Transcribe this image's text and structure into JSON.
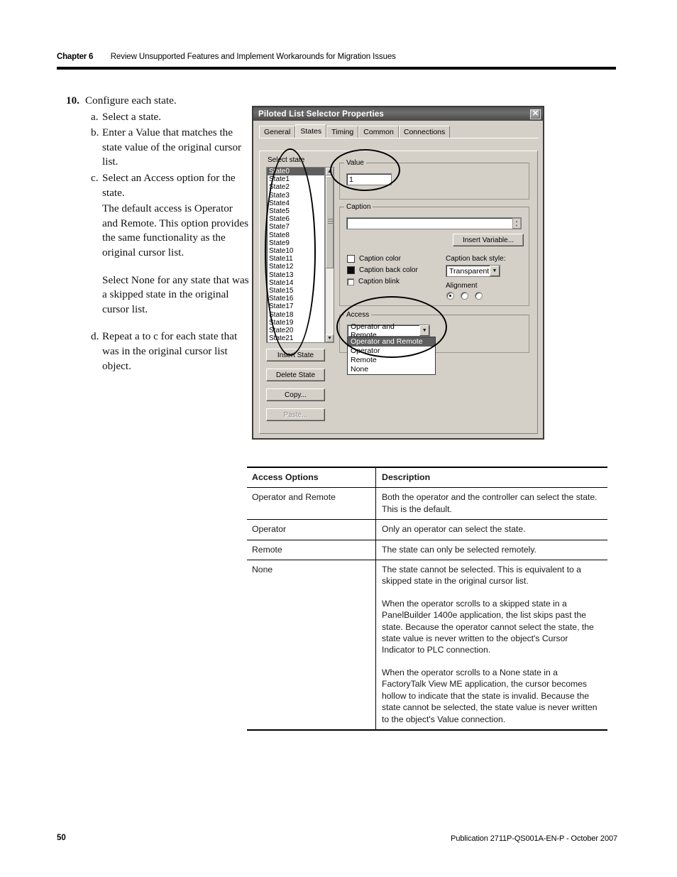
{
  "header": {
    "chapter_label": "Chapter 6",
    "chapter_title": "Review Unsupported Features and Implement Workarounds for Migration Issues"
  },
  "instructions": {
    "step_number": "10.",
    "step_text": "Configure each state.",
    "sub_steps": [
      {
        "letter": "a.",
        "text": "Select a state."
      },
      {
        "letter": "b.",
        "text": "Enter a Value that matches the state value of the original cursor list."
      },
      {
        "letter": "c.",
        "text": "Select an Access option for the state."
      },
      {
        "letter": "d.",
        "text": "Repeat a to c for each state that was in the original cursor list object."
      }
    ],
    "note_default_access": "The default access is Operator and Remote. This option provides the same functionality as the original cursor list.",
    "note_select_none": "Select None for any state that was a skipped state in the original cursor list."
  },
  "dialog": {
    "title": "Piloted List Selector Properties",
    "close_label": "✕",
    "tabs": [
      {
        "label": "General",
        "active": false
      },
      {
        "label": "States",
        "active": true
      },
      {
        "label": "Timing",
        "active": false
      },
      {
        "label": "Common",
        "active": false
      },
      {
        "label": "Connections",
        "active": false
      }
    ],
    "select_state_label": "Select state",
    "states": [
      "State0",
      "State1",
      "State2",
      "State3",
      "State4",
      "State5",
      "State6",
      "State7",
      "State8",
      "State9",
      "State10",
      "State11",
      "State12",
      "State13",
      "State14",
      "State15",
      "State16",
      "State17",
      "State18",
      "State19",
      "State20",
      "State21"
    ],
    "selected_state": "State0",
    "scroll_up_glyph": "▲",
    "scroll_down_glyph": "▼",
    "left_buttons": [
      {
        "label": "Insert State",
        "enabled": true
      },
      {
        "label": "Delete State",
        "enabled": true
      },
      {
        "label": "Copy...",
        "enabled": true
      },
      {
        "label": "Paste...",
        "enabled": false
      }
    ],
    "value_group": {
      "label": "Value",
      "value": "1"
    },
    "caption_group": {
      "label": "Caption",
      "caption_text": "",
      "insert_variable_label": "Insert Variable...",
      "caption_color_label": "Caption color",
      "caption_color_swatch": "#ffffff",
      "caption_back_color_label": "Caption back color",
      "caption_back_color_swatch": "#000000",
      "caption_blink_label": "Caption blink",
      "caption_blink_checked": false,
      "back_style_label": "Caption back style:",
      "back_style_value": "Transparent",
      "alignment_label": "Alignment",
      "alignment_selected_index": 0
    },
    "access_group": {
      "label": "Access",
      "selected": "Operator and Remote",
      "options": [
        "Operator and Remote",
        "Operator",
        "Remote",
        "None"
      ],
      "dropdown_open": true
    }
  },
  "table": {
    "columns": [
      "Access Options",
      "Description"
    ],
    "rows": [
      {
        "option": "Operator and Remote",
        "description": [
          "Both the operator and the controller can select the state. This is the default."
        ]
      },
      {
        "option": "Operator",
        "description": [
          "Only an operator can select the state."
        ]
      },
      {
        "option": "Remote",
        "description": [
          "The state can only be selected remotely."
        ]
      },
      {
        "option": "None",
        "description": [
          "The state cannot be selected. This is equivalent to a skipped state in the original cursor list.",
          "When the operator scrolls to a skipped state in a PanelBuilder 1400e application, the list skips past the state. Because the operator cannot select the state, the state value is never written to the object's Cursor Indicator to PLC connection.",
          "When the operator scrolls to a None state in a FactoryTalk View ME application, the cursor becomes hollow to indicate that the state is invalid. Because the state cannot be selected, the state value is never written to the object's Value connection."
        ]
      }
    ]
  },
  "footer": {
    "page_number": "50",
    "publication": "Publication 2711P-QS001A-EN-P - October 2007"
  }
}
